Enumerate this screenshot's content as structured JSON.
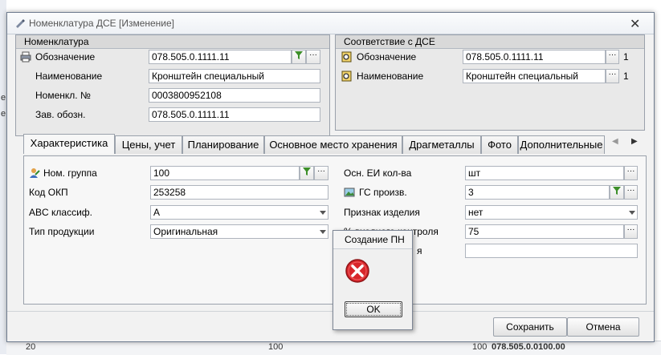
{
  "window": {
    "title": "Номенклатура ДСЕ [Изменение]"
  },
  "nomenclature_group": {
    "title": "Номенклатура",
    "designation": {
      "label": "Обозначение",
      "value": "078.505.0.1111.11"
    },
    "name": {
      "label": "Наименование",
      "value": "Кронштейн специальный"
    },
    "nomencl_no": {
      "label": "Номенкл. №",
      "value": "0003800952108"
    },
    "factory_desig": {
      "label": "Зав. обозн.",
      "value": "078.505.0.1111.11"
    }
  },
  "match_group": {
    "title": "Соответствие с ДСЕ",
    "designation": {
      "label": "Обозначение",
      "value": "078.505.0.1111.11",
      "count": "1"
    },
    "name": {
      "label": "Наименование",
      "value": "Кронштейн специальный",
      "count": "1"
    }
  },
  "tabs": [
    {
      "label": "Характеристика"
    },
    {
      "label": "Цены, учет"
    },
    {
      "label": "Планирование"
    },
    {
      "label": "Основное место хранения"
    },
    {
      "label": "Драгметаллы"
    },
    {
      "label": "Фото"
    },
    {
      "label": "Дополнительные"
    }
  ],
  "characteristics": {
    "nom_group": {
      "label": "Ном. группа",
      "value": "100"
    },
    "okp_code": {
      "label": "Код ОКП",
      "value": "253258"
    },
    "abc_class": {
      "label": "ABC классиф.",
      "value": "A"
    },
    "product_type": {
      "label": "Тип продукции",
      "value": "Оригинальная"
    },
    "main_unit": {
      "label": "Осн. ЕИ кол-ва",
      "value": "шт"
    },
    "gs_prod": {
      "label": "ГС произв.",
      "value": "3"
    },
    "item_flag": {
      "label": "Признак изделия",
      "value": "нет"
    },
    "incoming_ctrl": {
      "label": "% входного контроля",
      "value": "75"
    },
    "hidden_label_tail": "я",
    "extra_field": {
      "value": ""
    }
  },
  "buttons": {
    "save": "Сохранить",
    "cancel": "Отмена"
  },
  "dialog": {
    "title": "Создание ПН",
    "ok": "OK"
  },
  "background": {
    "left_text_1": "е",
    "left_text_2": "е",
    "bottom_num_1": "20",
    "bottom_num_2": "100",
    "bottom_num_3": "100",
    "bottom_code": "078.505.0.0100.00"
  }
}
